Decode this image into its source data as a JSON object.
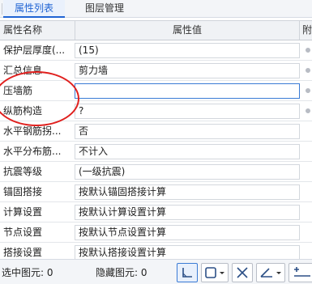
{
  "tabs": [
    {
      "label": "属性列表",
      "active": true
    },
    {
      "label": "图层管理",
      "active": false
    }
  ],
  "table": {
    "columns": {
      "name": "属性名称",
      "value": "属性值",
      "extra": "附"
    },
    "rows": [
      {
        "name": "保护层厚度(...",
        "value": "(15)"
      },
      {
        "name": "汇总信息",
        "value": "剪力墙"
      },
      {
        "name": "压墙筋",
        "value": ""
      },
      {
        "name": "纵筋构造",
        "value": "?"
      },
      {
        "name": "水平钢筋拐...",
        "value": "否"
      },
      {
        "name": "水平分布筋...",
        "value": "不计入"
      },
      {
        "name": "抗震等级",
        "value": "(一级抗震)"
      },
      {
        "name": "锚固搭接",
        "value": "按默认锚固搭接计算"
      },
      {
        "name": "计算设置",
        "value": "按默认计算设置计算"
      },
      {
        "name": "节点设置",
        "value": "按默认节点设置计算"
      },
      {
        "name": "搭接设置",
        "value": "按默认搭接设置计算"
      }
    ]
  },
  "status": {
    "selected_label": "选中图元: 0",
    "hidden_label": "隐藏图元: 0"
  },
  "toolbar": {
    "buttons": [
      {
        "icon": "corner-snap-icon",
        "pressed": true
      },
      {
        "icon": "square-select-dropdown-icon",
        "pressed": false
      },
      {
        "icon": "cross-icon",
        "pressed": false
      },
      {
        "icon": "angle-dropdown-icon",
        "pressed": false
      },
      {
        "icon": "plus-line-icon",
        "pressed": false
      }
    ]
  },
  "colors": {
    "accent": "#1f63d3",
    "annotation": "#e0201e",
    "active_input_border": "#3a7bd5"
  }
}
